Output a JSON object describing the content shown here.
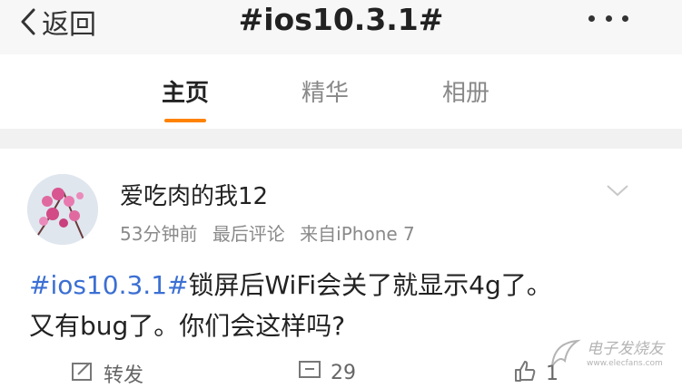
{
  "navbar": {
    "back_label": "返回",
    "title": "#ios10.3.1#"
  },
  "tabs": [
    {
      "label": "主页",
      "active": true
    },
    {
      "label": "精华",
      "active": false
    },
    {
      "label": "相册",
      "active": false
    }
  ],
  "post": {
    "username": "爱吃肉的我12",
    "time": "53分钟前",
    "status": "最后评论",
    "source": "来自iPhone 7",
    "hashtag": "#ios10.3.1#",
    "text_line1": "锁屏后WiFi会关了就显示4g了。",
    "text_line2": "又有bug了。你们会这样吗?"
  },
  "actions": {
    "repost_label": "转发",
    "comment_count": "29",
    "like_count": "1"
  },
  "watermark": {
    "name": "电子发烧友",
    "url": "www.elecfans.com"
  },
  "colors": {
    "accent": "#ff8200",
    "link": "#3b6fd3"
  },
  "icons": [
    "back-chevron-icon",
    "more-icon",
    "expand-chevron-icon",
    "repost-icon",
    "comment-icon",
    "like-icon",
    "watermark-logo-icon"
  ]
}
